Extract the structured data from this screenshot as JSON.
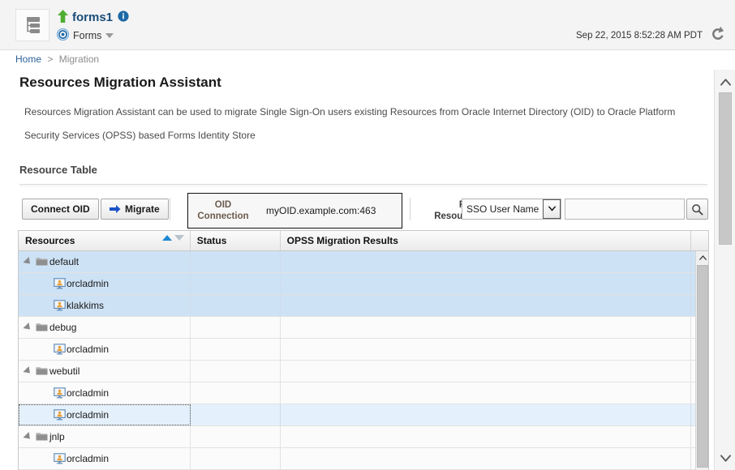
{
  "header": {
    "tree_icon": "tree-outline-icon",
    "up_arrow_icon": "green-up-arrow-icon",
    "app_title": "forms1",
    "info_icon": "info-icon",
    "target_icon": "target-icon",
    "app_type": "Forms",
    "dropdown_icon": "chevron-down-icon",
    "timestamp": "Sep 22, 2015 8:52:28 AM PDT",
    "refresh_icon": "refresh-icon"
  },
  "breadcrumb": {
    "home": "Home",
    "separator": ">",
    "current": "Migration"
  },
  "page": {
    "title": "Resources Migration Assistant",
    "description": "Resources Migration Assistant can be used to migrate Single Sign-On users existing Resources from Oracle Internet Directory (OID) to Oracle Platform Security Services (OPSS) based Forms Identity Store",
    "section_title": "Resource Table"
  },
  "toolbar": {
    "connect_oid_label": "Connect OID",
    "migrate_label": "Migrate",
    "migrate_icon": "blue-right-arrow-icon",
    "oid_connection_label": "OID Connection",
    "oid_connection_value": "myOID.example.com:463",
    "filter_label": "Filter Resources",
    "filter_select_value": "SSO User Name",
    "filter_select_options": [
      "SSO User Name"
    ],
    "filter_select_icon": "chevron-down-icon",
    "filter_input_value": "",
    "filter_input_placeholder": "",
    "search_icon": "search-icon"
  },
  "table": {
    "columns": [
      {
        "label": "Resources",
        "sort": "ascending"
      },
      {
        "label": "Status"
      },
      {
        "label": "OPSS Migration Results"
      }
    ],
    "sort_asc_icon": "triangle-up-icon",
    "sort_desc_icon": "triangle-down-icon",
    "rows": [
      {
        "label": "default",
        "type": "folder",
        "depth": 0,
        "expanded": true,
        "state": "selected",
        "status": "",
        "results": ""
      },
      {
        "label": "orcladmin",
        "type": "user",
        "depth": 1,
        "expanded": false,
        "state": "selected",
        "status": "",
        "results": ""
      },
      {
        "label": "klakkims",
        "type": "user",
        "depth": 1,
        "expanded": false,
        "state": "selected",
        "status": "",
        "results": ""
      },
      {
        "label": "debug",
        "type": "folder",
        "depth": 0,
        "expanded": true,
        "state": "normal",
        "status": "",
        "results": ""
      },
      {
        "label": "orcladmin",
        "type": "user",
        "depth": 1,
        "expanded": false,
        "state": "normal",
        "status": "",
        "results": ""
      },
      {
        "label": "webutil",
        "type": "folder",
        "depth": 0,
        "expanded": true,
        "state": "normal",
        "status": "",
        "results": ""
      },
      {
        "label": "orcladmin",
        "type": "user",
        "depth": 1,
        "expanded": false,
        "state": "normal",
        "status": "",
        "results": ""
      },
      {
        "label": "orcladmin",
        "type": "user",
        "depth": 1,
        "expanded": false,
        "state": "focused",
        "status": "",
        "results": ""
      },
      {
        "label": "jnlp",
        "type": "folder",
        "depth": 0,
        "expanded": true,
        "state": "normal",
        "status": "",
        "results": ""
      },
      {
        "label": "orcladmin",
        "type": "user",
        "depth": 1,
        "expanded": false,
        "state": "normal",
        "status": "",
        "results": ""
      }
    ],
    "scroll_up_icon": "chevron-up-icon"
  },
  "page_scroll": {
    "up_icon": "chevron-up-icon",
    "down_icon": "chevron-down-icon"
  },
  "colors": {
    "link": "#2a6099",
    "title": "#1a4d7a",
    "selected_row": "#cde2f5",
    "focused_row": "#e4f0fb",
    "sort_active": "#1f88d4",
    "migrate_arrow": "#1a52c8",
    "up_arrow": "#4fae32",
    "oid_label": "#6a5b4d"
  }
}
